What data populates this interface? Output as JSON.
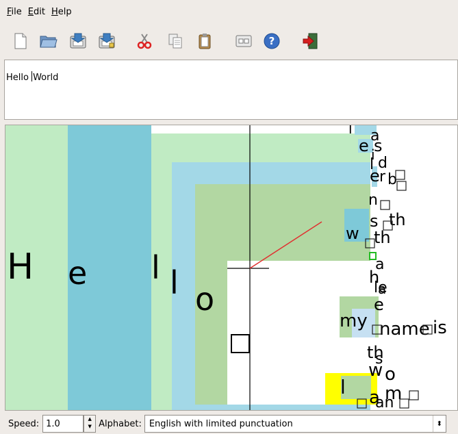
{
  "menubar": {
    "items": [
      {
        "mnemonic": "F",
        "rest": "ile"
      },
      {
        "mnemonic": "E",
        "rest": "dit"
      },
      {
        "mnemonic": "H",
        "rest": "elp"
      }
    ]
  },
  "toolbar": {
    "icons": [
      "new-file-icon",
      "open-folder-icon",
      "save-icon",
      "save-as-icon",
      "cut-icon",
      "copy-icon",
      "paste-icon",
      "preferences-icon",
      "help-icon",
      "exit-icon"
    ]
  },
  "editor": {
    "text_before_caret": "Hello ",
    "text_after_caret": "World"
  },
  "canvas": {
    "big_letters": [
      "H",
      "e",
      "l",
      "l",
      "o"
    ],
    "right_letters": [
      "l",
      "a",
      "e",
      "s",
      "i",
      "d",
      "l",
      "e",
      "r",
      "b",
      "n",
      "s",
      "th",
      "w",
      "th",
      "a",
      "h",
      "a",
      "le",
      "e",
      "my",
      "name",
      "is",
      "th",
      "s",
      "w",
      "o",
      "l",
      "a",
      "m",
      "an"
    ]
  },
  "statusbar": {
    "speed_label": "Speed:",
    "speed_value": "1.0",
    "alphabet_label": "Alphabet:",
    "alphabet_value": "English with limited punctuation"
  },
  "colors": {
    "light_green": "#c0ebc3",
    "blue": "#7ec9d8",
    "light_blue": "#a3d8e7",
    "sage": "#b2d7a2",
    "yellow": "#ffff00",
    "red_line": "#e03030"
  }
}
